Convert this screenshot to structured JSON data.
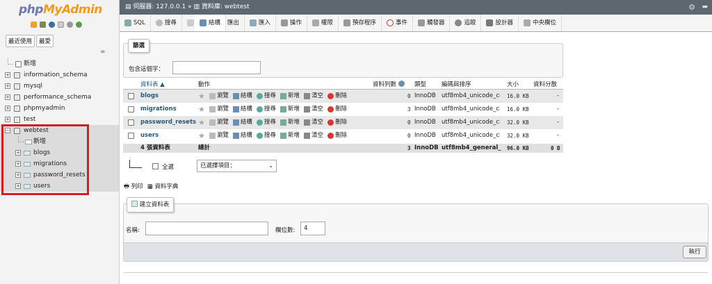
{
  "nav": {
    "logo_php": "php",
    "logo_myadmin": "MyAdmin",
    "tabs": [
      "最近使用",
      "最愛"
    ],
    "new_label": "新增",
    "databases": [
      "information_schema",
      "mysql",
      "performance_schema",
      "phpmyadmin",
      "test"
    ],
    "expanded_db": "webtest",
    "expanded_new": "新增",
    "tables": [
      "blogs",
      "migrations",
      "password_resets",
      "users"
    ]
  },
  "topbar": {
    "server_label": "伺服器: 127.0.0.1",
    "separator": "»",
    "db_label": "資料庫: webtest"
  },
  "tabs": [
    {
      "label": "結構",
      "icon": "structure-icon",
      "active": true
    },
    {
      "label": "SQL",
      "icon": "sql-icon"
    },
    {
      "label": "搜尋",
      "icon": "search-icon"
    },
    {
      "label": "查詢",
      "icon": "query-icon"
    },
    {
      "label": "匯出",
      "icon": "export-icon"
    },
    {
      "label": "匯入",
      "icon": "import-icon"
    },
    {
      "label": "操作",
      "icon": "operations-icon"
    },
    {
      "label": "權限",
      "icon": "privileges-icon"
    },
    {
      "label": "預存程序",
      "icon": "routines-icon"
    },
    {
      "label": "事件",
      "icon": "events-icon"
    },
    {
      "label": "觸發器",
      "icon": "triggers-icon"
    },
    {
      "label": "追蹤",
      "icon": "tracking-icon"
    },
    {
      "label": "設計器",
      "icon": "designer-icon"
    },
    {
      "label": "中央欄位",
      "icon": "central-columns-icon"
    }
  ],
  "filter": {
    "legend": "篩選",
    "label": "包含這個字："
  },
  "table": {
    "headers": {
      "name": "資料表",
      "action": "動作",
      "rows": "資料列數",
      "type": "類型",
      "collation": "編碼與排序",
      "size": "大小",
      "overhead": "資料分散"
    },
    "actions": [
      "瀏覽",
      "結構",
      "搜尋",
      "新增",
      "清空",
      "刪除"
    ],
    "rows": [
      {
        "name": "blogs",
        "rows": "0",
        "type": "InnoDB",
        "collation": "utf8mb4_unicode_ci",
        "size": "16.0 KB",
        "overhead": "-"
      },
      {
        "name": "migrations",
        "rows": "3",
        "type": "InnoDB",
        "collation": "utf8mb4_unicode_ci",
        "size": "16.0 KB",
        "overhead": "-"
      },
      {
        "name": "password_resets",
        "rows": "0",
        "type": "InnoDB",
        "collation": "utf8mb4_unicode_ci",
        "size": "32.0 KB",
        "overhead": "-"
      },
      {
        "name": "users",
        "rows": "0",
        "type": "InnoDB",
        "collation": "utf8mb4_unicode_ci",
        "size": "32.0 KB",
        "overhead": "-"
      }
    ],
    "footer": {
      "count": "4 張資料表",
      "label": "總計",
      "rows": "3",
      "type": "InnoDB",
      "collation": "utf8mb4_general_ci",
      "size": "96.0 KB",
      "overhead": "0 B"
    }
  },
  "bulk": {
    "select_all": "全選",
    "with_selected": "已選擇項目："
  },
  "links": {
    "print": "列印",
    "dictionary": "資料字典"
  },
  "create": {
    "legend": "建立資料表",
    "name_label": "名稱:",
    "name_value": "",
    "cols_label": "欄位數:",
    "cols_value": "4",
    "go": "執行"
  }
}
